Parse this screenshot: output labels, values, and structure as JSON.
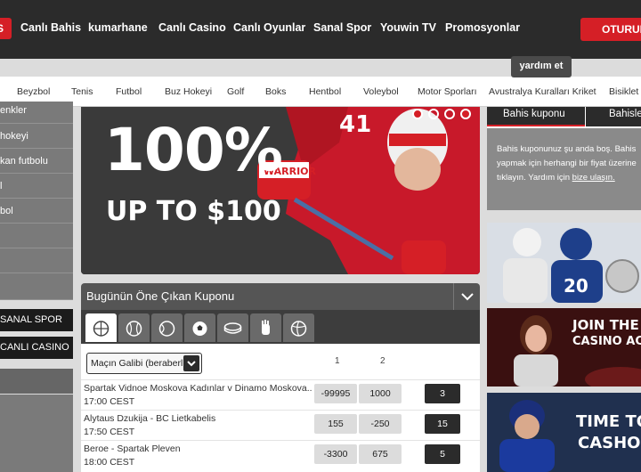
{
  "topnav": {
    "left_tab": "S",
    "items": [
      "Canlı Bahis",
      "kumarhane",
      "Canlı Casino",
      "Canlı Oyunlar",
      "Sanal Spor",
      "Youwin TV",
      "Promosyonlar"
    ],
    "login": "OTURUM"
  },
  "help": {
    "label": "yardım et"
  },
  "sports": [
    "Beyzbol",
    "Tenis",
    "Futbol",
    "Buz Hokeyi",
    "Golf",
    "Boks",
    "Hentbol",
    "Voleybol",
    "Motor Sporları",
    "Avustralya Kuralları Kriket",
    "Bisiklet s"
  ],
  "sidebar": {
    "items": [
      "enkler",
      "hokeyi",
      "kan futbolu",
      "l",
      "bol",
      "",
      "",
      ""
    ],
    "dark": [
      "SANAL SPOR",
      "CANLI CASINO"
    ]
  },
  "banner": {
    "headline": "100%",
    "subline": "UP TO $100",
    "jersey_brand": "WARRIOR",
    "jersey_number": "41"
  },
  "coupon": {
    "title": "Bugünün Öne Çıkan Kuponu",
    "market": "Maçın Galibi (beraberl...",
    "col1": "1",
    "col2": "2",
    "matches": [
      {
        "name": "Spartak Vidnoe Moskova Kadınlar v Dinamo Moskova...",
        "time": "17:00 CEST",
        "odd1": "-99995",
        "odd2": "1000",
        "more": "3"
      },
      {
        "name": "Alytaus Dzukija - BC Lietkabelis",
        "time": "17:50 CEST",
        "odd1": "155",
        "odd2": "-250",
        "more": "15"
      },
      {
        "name": "Beroe - Spartak Pleven",
        "time": "18:00 CEST",
        "odd1": "-3300",
        "odd2": "675",
        "more": "5"
      }
    ]
  },
  "betslip": {
    "tab1": "Bahis kuponu",
    "tab2": "Bahisle",
    "line1": "Bahis kuponunuz şu anda boş. Bahis",
    "line2": "yapmak için herhangi bir fiyat üzerine",
    "line3": "tıklayın. Yardım için",
    "link": "bize ulaşın."
  },
  "promos": {
    "casino_line1": "JOIN THE",
    "casino_line2": "CASINO AC",
    "cashout_line1": "TIME TO",
    "cashout_line2": "CASHO",
    "jersey_number": "20"
  },
  "colors": {
    "accent": "#d51f26",
    "nav_bg": "#2b2b2b",
    "panel_bg": "#555555"
  }
}
